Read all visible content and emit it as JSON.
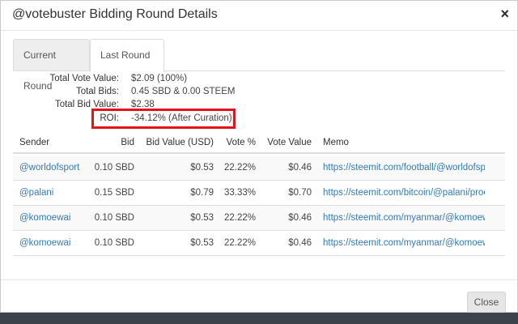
{
  "modal": {
    "title": "@votebuster Bidding Round Details",
    "close_icon": "×",
    "close_button_label": "Close"
  },
  "tabs": [
    {
      "label": "Current Round",
      "active": false
    },
    {
      "label": "Last Round",
      "active": true
    }
  ],
  "summary": {
    "total_vote_value": {
      "label": "Total Vote Value:",
      "value": "$2.09 (100%)"
    },
    "total_bids": {
      "label": "Total Bids:",
      "value": "0.45 SBD & 0.00 STEEM"
    },
    "total_bid_value": {
      "label": "Total Bid Value:",
      "value": "$2.38"
    },
    "roi": {
      "label": "ROI:",
      "value": "-34.12% (After Curation)"
    }
  },
  "table": {
    "columns": [
      "Sender",
      "Bid",
      "Bid Value (USD)",
      "Vote %",
      "Vote Value",
      "Memo"
    ],
    "rows": [
      {
        "sender": "@worldofsport",
        "bid": "0.10 SBD",
        "bid_value": "$0.53",
        "vote_pct": "22.22%",
        "vote_value": "$0.46",
        "memo": "https://steemit.com/football/@worldofsport"
      },
      {
        "sender": "@palani",
        "bid": "0.15 SBD",
        "bid_value": "$0.79",
        "vote_pct": "33.33%",
        "vote_value": "$0.70",
        "memo": "https://steemit.com/bitcoin/@palani/proc"
      },
      {
        "sender": "@komoewai",
        "bid": "0.10 SBD",
        "bid_value": "$0.53",
        "vote_pct": "22.22%",
        "vote_value": "$0.46",
        "memo": "https://steemit.com/myanmar/@komoewai"
      },
      {
        "sender": "@komoewai",
        "bid": "0.10 SBD",
        "bid_value": "$0.53",
        "vote_pct": "22.22%",
        "vote_value": "$0.46",
        "memo": "https://steemit.com/myanmar/@komoewai"
      }
    ]
  },
  "colors": {
    "link": "#337ab7",
    "highlight": "#e8101a"
  }
}
